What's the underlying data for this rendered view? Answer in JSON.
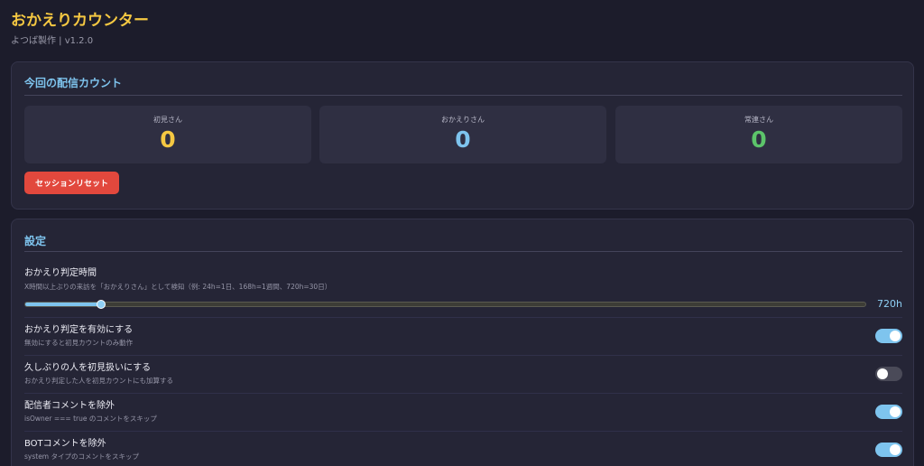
{
  "app": {
    "title": "おかえりカウンター",
    "subtitle": "よつば製作 | v1.2.0"
  },
  "session": {
    "heading": "今回の配信カウント",
    "counters": [
      {
        "label": "初見さん",
        "value": "0",
        "color": "#f5c842"
      },
      {
        "label": "おかえりさん",
        "value": "0",
        "color": "#7ec4ee"
      },
      {
        "label": "常連さん",
        "value": "0",
        "color": "#5cc46a"
      }
    ],
    "reset_label": "セッションリセット"
  },
  "settings": {
    "heading": "設定",
    "threshold": {
      "title": "おかえり判定時間",
      "description": "X時間以上ぶりの来訪を「おかえりさん」として検知（例: 24h=1日、168h=1週間、720h=30日）",
      "value_label": "720h",
      "fraction": 0.09
    },
    "toggles": [
      {
        "title": "おかえり判定を有効にする",
        "description": "無効にすると初見カウントのみ動作",
        "on": true
      },
      {
        "title": "久しぶりの人を初見扱いにする",
        "description": "おかえり判定した人を初見カウントにも加算する",
        "on": false
      },
      {
        "title": "配信者コメントを除外",
        "description": "isOwner === true のコメントをスキップ",
        "on": true
      },
      {
        "title": "BOTコメントを除外",
        "description": "system タイプのコメントをスキップ",
        "on": true
      }
    ]
  }
}
